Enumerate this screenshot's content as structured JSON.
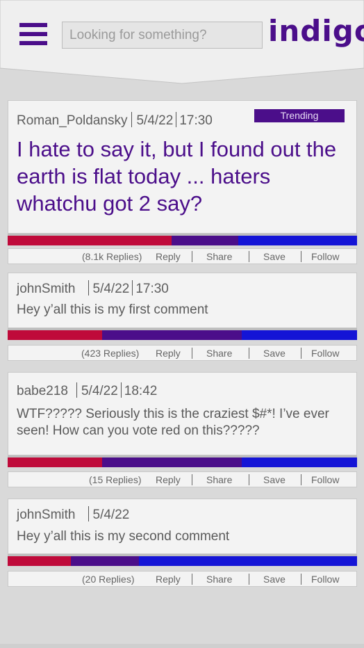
{
  "header": {
    "search_placeholder": "Looking for something?",
    "logo": "indigo"
  },
  "colors": {
    "accent": "#4b0e8a",
    "red": "#bf0a3a",
    "blue": "#1414d6"
  },
  "posts": [
    {
      "user": "Roman_Poldansky",
      "date": "5/4/22",
      "time": "17:30",
      "badge": "Trending",
      "text": "I hate to say it, but I found out the earth is flat today ... haters whatchu got 2 say?",
      "votes": {
        "red": 0.47,
        "purple": 0.19,
        "blue": 0.34
      },
      "replies": "(8.1k Replies)",
      "reply": "Reply",
      "share": "Share",
      "save": "Save",
      "follow": "Follow"
    },
    {
      "user": "johnSmith",
      "date": "5/4/22",
      "time": "17:30",
      "text": "Hey y’all this is my first comment",
      "votes": {
        "red": 0.27,
        "purple": 0.4,
        "blue": 0.33
      },
      "replies": "(423 Replies)",
      "reply": "Reply",
      "share": "Share",
      "save": "Save",
      "follow": "Follow"
    },
    {
      "user": "babe218",
      "date": "5/4/22",
      "time": "18:42",
      "text": "WTF????? Seriously this is the craziest $#*! I’ve ever seen! How can you vote red on this?????",
      "votes": {
        "red": 0.27,
        "purple": 0.4,
        "blue": 0.33
      },
      "replies": "(15 Replies)",
      "reply": "Reply",
      "share": "Share",
      "save": "Save",
      "follow": "Follow"
    },
    {
      "user": "johnSmith",
      "date": "5/4/22",
      "text": "Hey y’all this is my second comment",
      "votes": {
        "red": 0.18,
        "purple": 0.195,
        "blue": 0.625
      },
      "replies": "(20  Replies)",
      "reply": "Reply",
      "share": "Share",
      "save": "Save",
      "follow": "Follow"
    }
  ]
}
